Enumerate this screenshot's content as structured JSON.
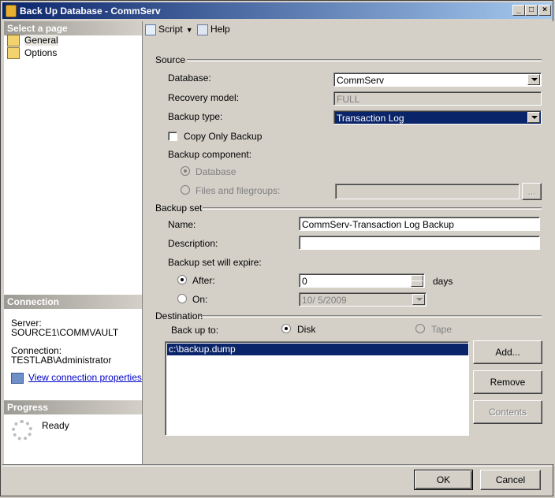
{
  "window": {
    "title": "Back Up Database - CommServ"
  },
  "left": {
    "select_page_header": "Select a page",
    "pages": [
      {
        "label": "General"
      },
      {
        "label": "Options"
      }
    ],
    "connection_header": "Connection",
    "server_label": "Server:",
    "server_value": "SOURCE1\\COMMVAULT",
    "connection_label": "Connection:",
    "connection_value": "TESTLAB\\Administrator",
    "view_props_link": "View connection properties",
    "progress_header": "Progress",
    "progress_status": "Ready"
  },
  "toolbar": {
    "script_label": "Script",
    "help_label": "Help"
  },
  "source": {
    "group_label": "Source",
    "database_label": "Database:",
    "database_value": "CommServ",
    "recovery_label": "Recovery model:",
    "recovery_value": "FULL",
    "backup_type_label": "Backup type:",
    "backup_type_value": "Transaction Log",
    "copy_only_label": "Copy Only Backup",
    "component_label": "Backup component:",
    "component_database": "Database",
    "component_files": "Files and filegroups:",
    "browse_label": "..."
  },
  "backup_set": {
    "group_label": "Backup set",
    "name_label": "Name:",
    "name_value": "CommServ-Transaction Log  Backup",
    "description_label": "Description:",
    "description_value": "",
    "expire_label": "Backup set will expire:",
    "after_label": "After:",
    "after_value": "0",
    "days_label": "days",
    "on_label": "On:",
    "on_value": "10/  5/2009"
  },
  "destination": {
    "group_label": "Destination",
    "back_up_to_label": "Back up to:",
    "disk_label": "Disk",
    "tape_label": "Tape",
    "items": [
      "c:\\backup.dump"
    ],
    "add_label": "Add...",
    "remove_label": "Remove",
    "contents_label": "Contents"
  },
  "footer": {
    "ok_label": "OK",
    "cancel_label": "Cancel"
  }
}
